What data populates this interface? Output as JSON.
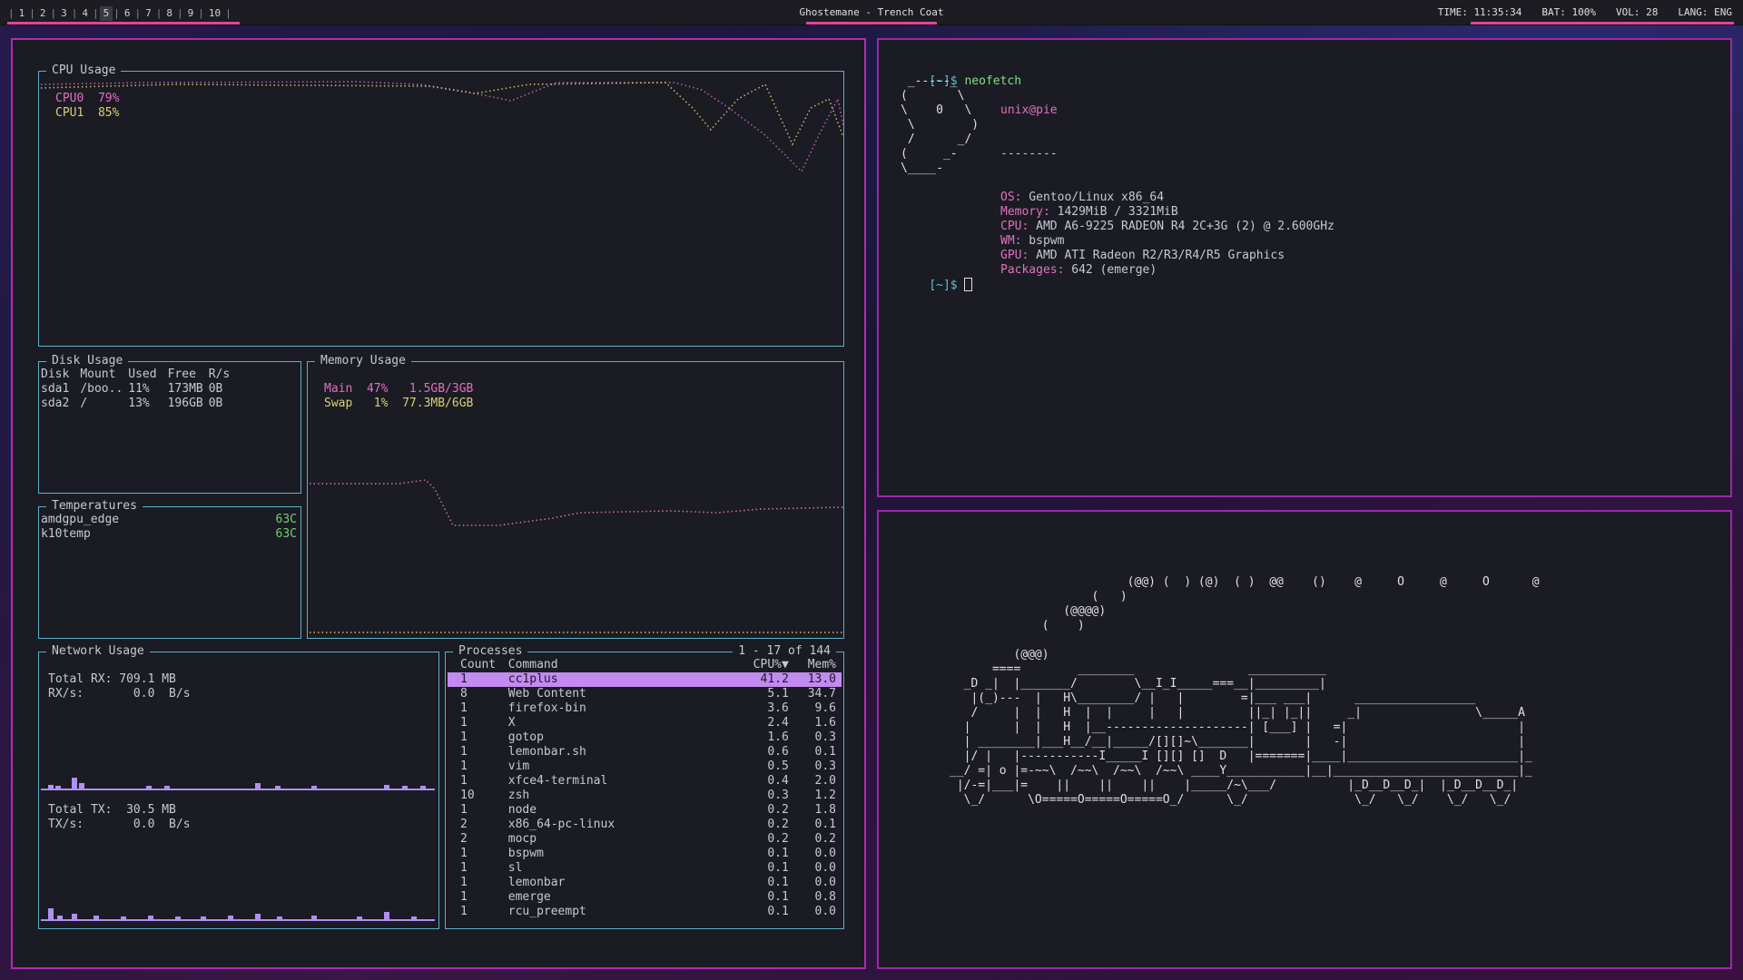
{
  "topbar": {
    "workspaces": [
      "1",
      "2",
      "3",
      "4",
      "5",
      "6",
      "7",
      "8",
      "9",
      "10"
    ],
    "active_workspace": "5",
    "window_title": "Ghostemane - Trench Coat",
    "time": "TIME: 11:35:34",
    "battery": "BAT: 100%",
    "volume": "VOL: 28",
    "lang": "LANG: ENG"
  },
  "cpu": {
    "title": "CPU Usage",
    "cpu0": "CPU0  79%",
    "cpu1": "CPU1  85%"
  },
  "disk": {
    "title": "Disk Usage",
    "headers": [
      "Disk",
      "Mount",
      "Used",
      "Free",
      "R/s"
    ],
    "rows": [
      [
        "sda1",
        "/boo..",
        "11%",
        "173MB",
        "0B"
      ],
      [
        "sda2",
        "/",
        "13%",
        "196GB",
        "0B"
      ]
    ]
  },
  "memory": {
    "title": "Memory Usage",
    "main": "Main  47%   1.5GB/3GB",
    "swap": "Swap   1%  77.3MB/6GB"
  },
  "temps": {
    "title": "Temperatures",
    "rows": [
      {
        "name": "amdgpu_edge",
        "value": "63C"
      },
      {
        "name": "k10temp",
        "value": "63C"
      }
    ]
  },
  "network": {
    "title": "Network Usage",
    "total_rx": "Total RX: 709.1 MB",
    "rx_rate": "RX/s:       0.0  B/s",
    "total_tx": "Total TX:  30.5 MB",
    "tx_rate": "TX/s:       0.0  B/s"
  },
  "processes": {
    "title": "Processes",
    "range": "1 - 17 of 144",
    "headers": [
      "Count",
      "Command",
      "CPU%▼",
      "Mem%"
    ],
    "rows": [
      [
        "1",
        "cc1plus",
        "41.2",
        "13.0"
      ],
      [
        "8",
        "Web Content",
        "5.1",
        "34.7"
      ],
      [
        "1",
        "firefox-bin",
        "3.6",
        "9.6"
      ],
      [
        "1",
        "X",
        "2.4",
        "1.6"
      ],
      [
        "1",
        "gotop",
        "1.6",
        "0.3"
      ],
      [
        "1",
        "lemonbar.sh",
        "0.6",
        "0.1"
      ],
      [
        "1",
        "vim",
        "0.5",
        "0.3"
      ],
      [
        "1",
        "xfce4-terminal",
        "0.4",
        "2.0"
      ],
      [
        "10",
        "zsh",
        "0.3",
        "1.2"
      ],
      [
        "1",
        "node",
        "0.2",
        "1.8"
      ],
      [
        "2",
        "x86_64-pc-linux",
        "0.2",
        "0.1"
      ],
      [
        "2",
        "mocp",
        "0.2",
        "0.2"
      ],
      [
        "1",
        "bspwm",
        "0.1",
        "0.0"
      ],
      [
        "1",
        "sl",
        "0.1",
        "0.0"
      ],
      [
        "1",
        "lemonbar",
        "0.1",
        "0.0"
      ],
      [
        "1",
        "emerge",
        "0.1",
        "0.8"
      ],
      [
        "1",
        "rcu_preempt",
        "0.1",
        "0.0"
      ]
    ]
  },
  "neofetch": {
    "prompt": "[~]$",
    "command": "neofetch",
    "userhost": "unix@pie",
    "separator": "--------",
    "ascii": [
      " _-----_",
      "(       \\",
      "\\    0   \\",
      " \\        )",
      " /      _/",
      "(     _-",
      "\\____-"
    ],
    "info": [
      {
        "key": "OS:",
        "value": " Gentoo/Linux x86_64"
      },
      {
        "key": "Memory:",
        "value": " 1429MiB / 3321MiB"
      },
      {
        "key": "CPU:",
        "value": " AMD A6-9225 RADEON R4 2C+3G (2) @ 2.600GHz"
      },
      {
        "key": "WM:",
        "value": " bspwm"
      },
      {
        "key": "GPU:",
        "value": " AMD ATI Radeon R2/R3/R4/R5 Graphics"
      },
      {
        "key": "Packages:",
        "value": " 642 (emerge)"
      }
    ],
    "prompt2": "[~]$ "
  },
  "sl_train": [
    "                         (@@) (  ) (@)  ( )  @@    ()    @     O     @     O      @",
    "                    (   )",
    "                (@@@@)",
    "             (    )",
    "",
    "         (@@@)",
    "      ====        ________                ___________",
    "  _D _|  |_______/        \\__I_I_____===__|_________|",
    "   |(_)---  |   H\\________/ |   |        =|___ ___|      _________________",
    "   /     |  |   H  |  |     |   |         ||_| |_||     _|                \\_____A",
    "  |      |  |   H  |__--------------------| [___] |   =|                        |",
    "  | ________|___H__/__|_____/[][]~\\_______|       |   -|                        |",
    "  |/ |   |-----------I_____I [][] []  D   |=======|____|________________________|_",
    "__/ =| o |=-~~\\  /~~\\  /~~\\  /~~\\ ____Y___________|__|__________________________|_",
    " |/-=|___|=    ||    ||    ||    |_____/~\\___/          |_D__D__D_|  |_D__D__D_|",
    "  \\_/      \\O=====O=====O=====O_/      \\_/               \\_/   \\_/    \\_/   \\_/"
  ]
}
